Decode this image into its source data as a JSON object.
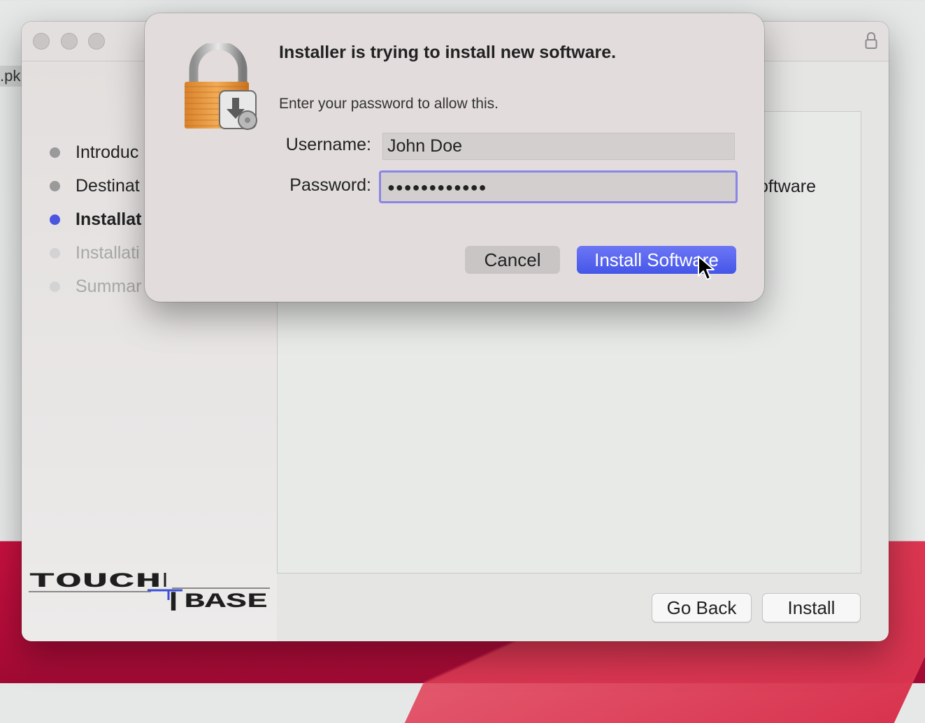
{
  "desktop": {
    "file_fragment": ".pk"
  },
  "window": {
    "steps": [
      {
        "label": "Introduc",
        "state": "done",
        "color": "#9a9a9a"
      },
      {
        "label": "Destinat",
        "state": "done",
        "color": "#9a9a9a"
      },
      {
        "label": "Installat",
        "state": "current",
        "color": "#4a55e0"
      },
      {
        "label": "Installati",
        "state": "pending",
        "color": "#d3d3d3"
      },
      {
        "label": "Summar",
        "state": "pending",
        "color": "#d3d3d3"
      }
    ],
    "panel_text_fragment": "oftware",
    "go_back_label": "Go Back",
    "install_label": "Install"
  },
  "dialog": {
    "title": "Installer is trying to install new software.",
    "message": "Enter your password to allow this.",
    "username_label": "Username:",
    "username_value": "John Doe",
    "password_label": "Password:",
    "password_value": "●●●●●●●●●●●●",
    "cancel_label": "Cancel",
    "install_software_label": "Install Software"
  },
  "colors": {
    "accent": "#4a55e0",
    "focus_ring": "#8a86e5"
  }
}
